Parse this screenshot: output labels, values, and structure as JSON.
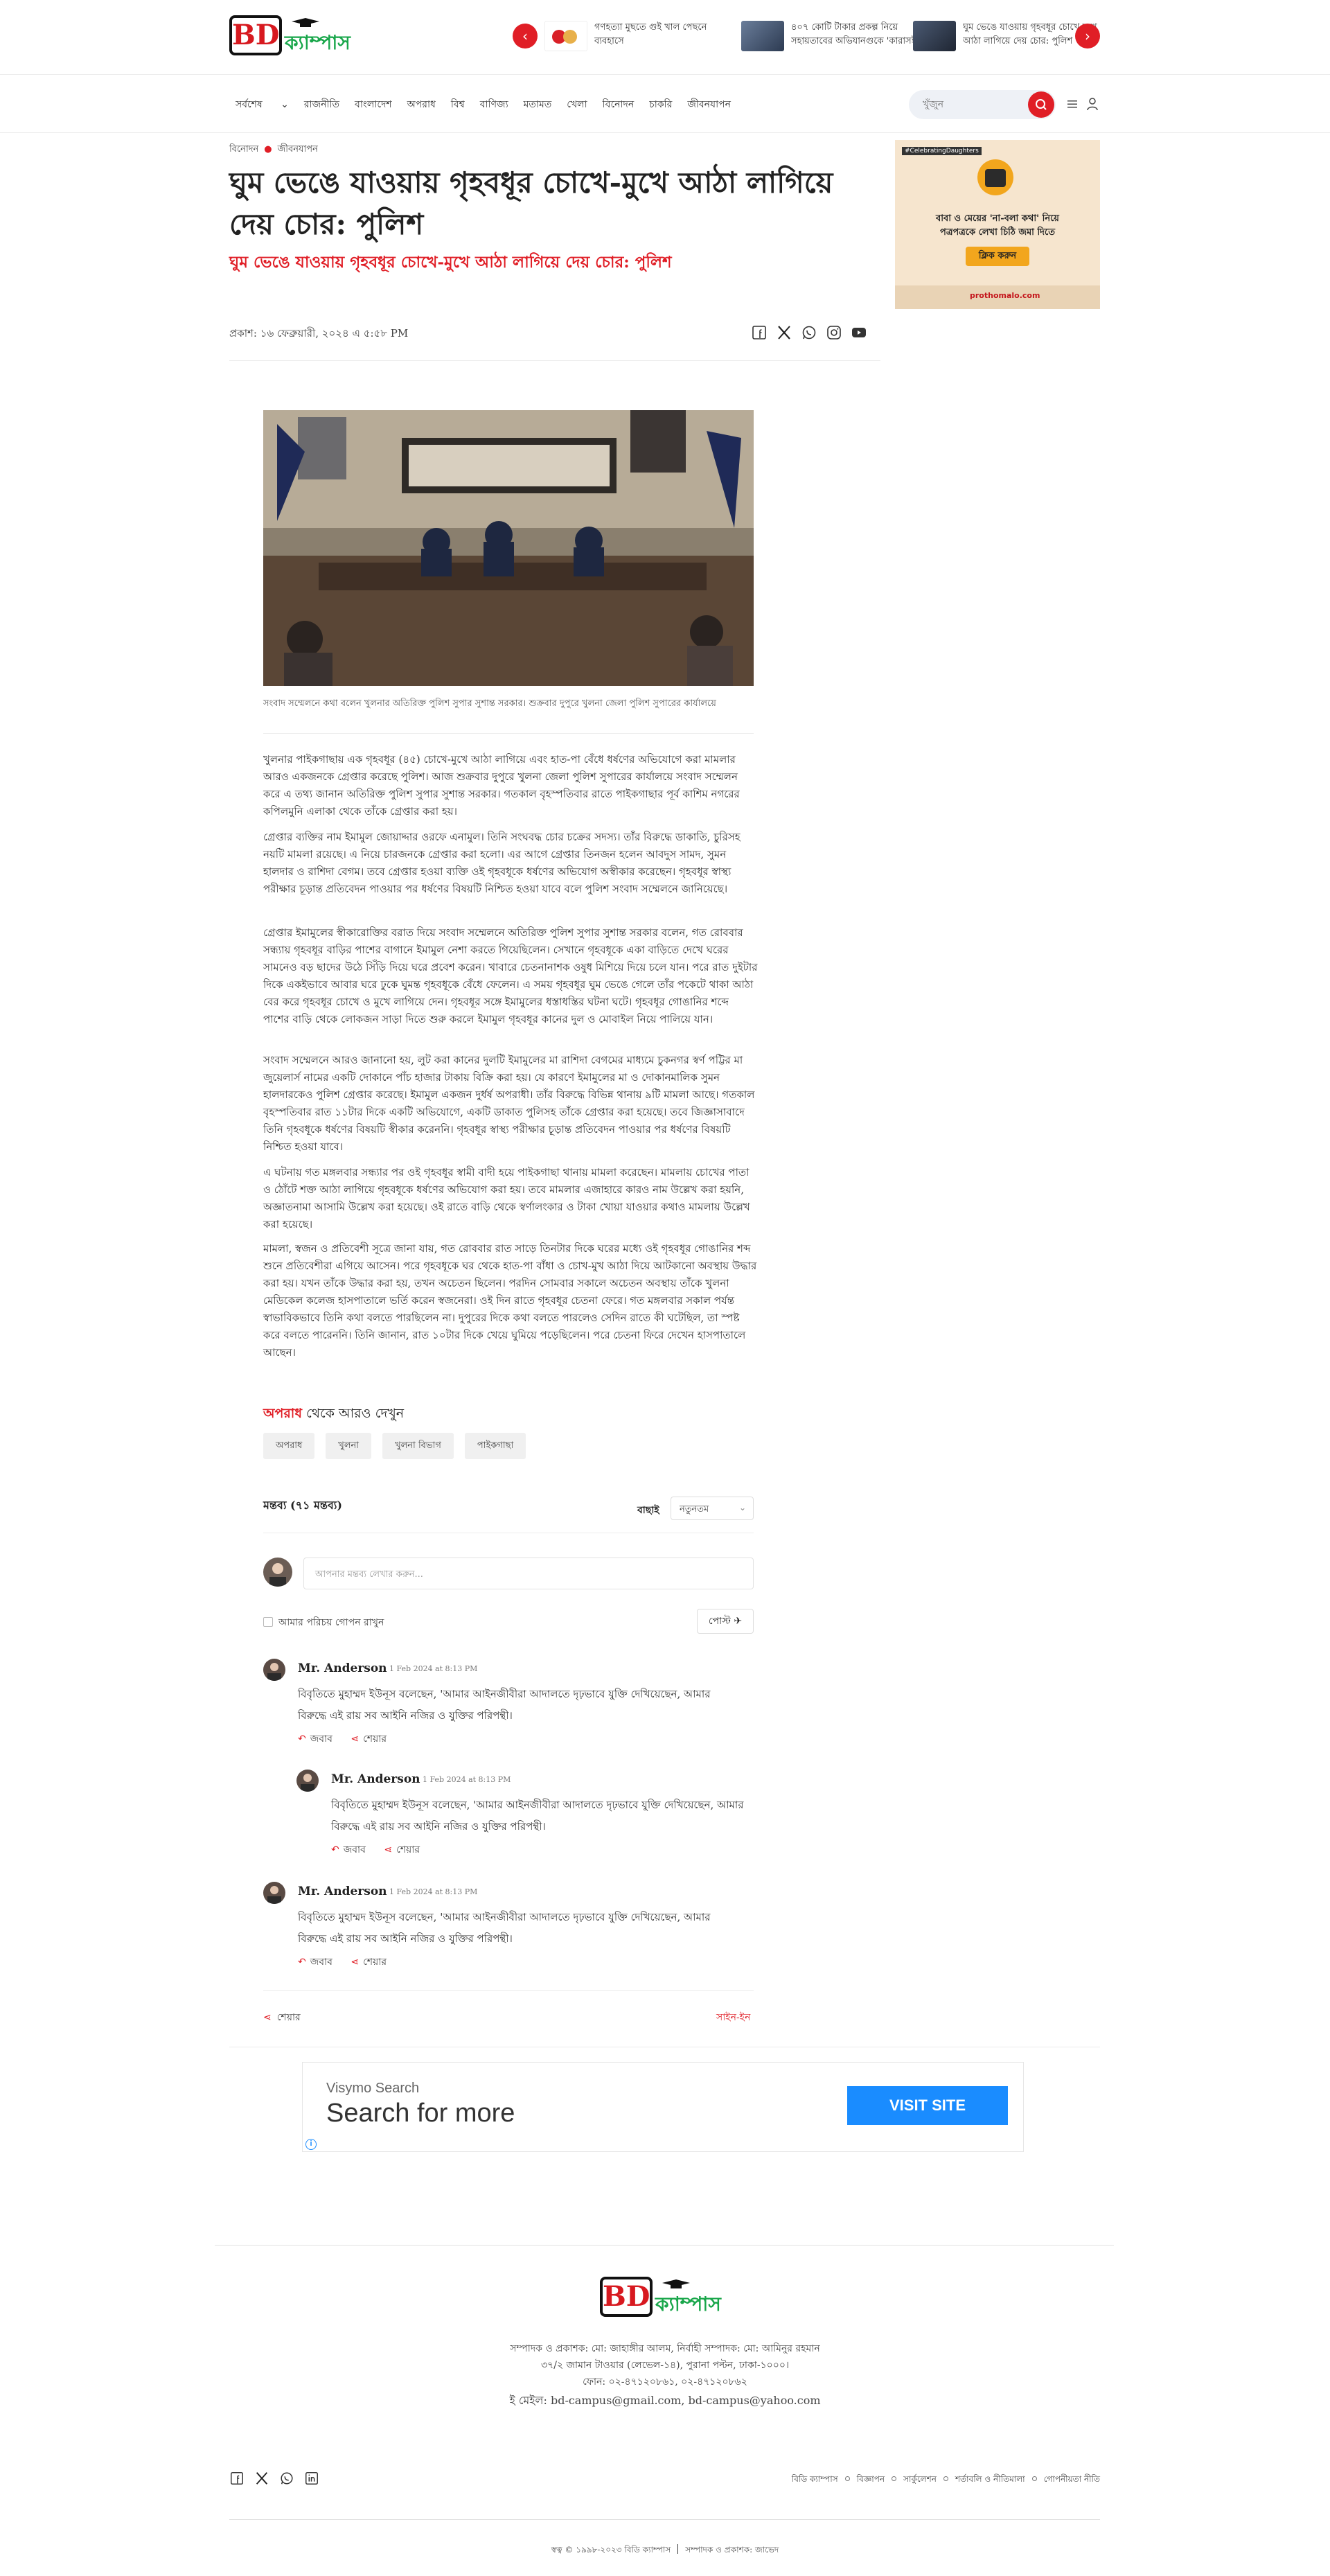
{
  "header": {
    "logo_bd": "BD",
    "logo_campus": "ক্যাম্পাস",
    "ticker": [
      "গণহত্যা মুছতে গুই খাল পেছনে ব্যবহাসে",
      "৪০৭ কোটি টাকার প্রকল্প নিয়ে সহায়তাবের অভিযানগুকে 'কারাসই...",
      "ঘুম ভেঙে যাওয়ায় গৃহবধূর চোখে-মুখে আঠা লাগিয়ে দেয় চোর: পুলিশ"
    ]
  },
  "nav": {
    "items": [
      "সর্বশেষ",
      "রাজনীতি",
      "বাংলাদেশ",
      "অপরাধ",
      "বিশ্ব",
      "বাণিজ্য",
      "মতামত",
      "খেলা",
      "বিনোদন",
      "চাকরি",
      "জীবনযাপন"
    ],
    "search_placeholder": "খুঁজুন"
  },
  "article": {
    "breadcrumb": [
      "বিনোদন",
      "জীবনযাপন"
    ],
    "title": "ঘুম ভেঙে যাওয়ায় গৃহবধূর চোখে-মুখে আঠা লাগিয়ে দেয় চোর: পুলিশ",
    "subtitle": "ঘুম ভেঙে যাওয়ায় গৃহবধূর চোখে-মুখে আঠা লাগিয়ে দেয় চোর: পুলিশ",
    "published": "প্রকাশ: ১৬ ফেব্রুয়ারী, ২০২৪ এ ৫:৫৮ PM",
    "photo_caption": "সংবাদ সম্মেলনে কথা বলেন খুলনার অতিরিক্ত পুলিশ সুপার সুশান্ত সরকার। শুক্রবার দুপুরে খুলনা জেলা পুলিশ সুপারের কার্যালয়ে",
    "paragraphs": [
      "খুলনার পাইকগাছায় এক গৃহবধূর (৪৫) চোখে-মুখে আঠা লাগিয়ে এবং হাত-পা বেঁধে ধর্ষণের অভিযোগে করা মামলার আরও একজনকে গ্রেপ্তার করেছে পুলিশ। আজ শুক্রবার দুপুরে খুলনা জেলা পুলিশ সুপারের কার্যালয়ে সংবাদ সম্মেলন করে এ তথ্য জানান অতিরিক্ত পুলিশ সুপার সুশান্ত সরকার। গতকাল বৃহস্পতিবার রাতে পাইকগাছার পূর্ব কাশিম নগরের কপিলমুনি এলাকা থেকে তাঁকে গ্রেপ্তার করা হয়।",
      "গ্রেপ্তার ব্যক্তির নাম ইমামুল জোয়াদ্দার ওরফে এনামুল। তিনি সংঘবদ্ধ চোর চক্রের সদস্য। তাঁর বিরুদ্ধে ডাকাতি, চুরিসহ নয়টি মামলা রয়েছে। এ নিয়ে চারজনকে গ্রেপ্তার করা হলো। এর আগে গ্রেপ্তার তিনজন হলেন আবদুস সামদ, সুমন হালদার ও রাশিদা বেগম। তবে গ্রেপ্তার হওয়া ব্যক্তি ওই গৃহবধূকে ধর্ষণের অভিযোগ অস্বীকার করেছেন। গৃহবধূর স্বাস্থ্য পরীক্ষার চূড়ান্ত প্রতিবেদন পাওয়ার পর ধর্ষণের বিষয়টি নিশ্চিত হওয়া যাবে বলে পুলিশ সংবাদ সম্মেলনে জানিয়েছে।",
      "গ্রেপ্তার ইমামুলের স্বীকারোক্তির বরাত দিয়ে সংবাদ সম্মেলনে অতিরিক্ত পুলিশ সুপার সুশান্ত সরকার বলেন, গত রোববার সন্ধ্যায় গৃহবধূর বাড়ির পাশের বাগানে ইমামুল নেশা করতে গিয়েছিলেন। সেখানে গৃহবধূকে একা বাড়িতে দেখে ঘরের সামনেও বড় ছাদের উঠে সিঁড়ি দিয়ে ঘরে প্রবেশ করেন। খাবারে চেতনানাশক ওষুধ মিশিয়ে দিয়ে চলে যান। পরে রাত দুইটার দিকে একইভাবে আবার ঘরে ঢুকে ঘুমন্ত গৃহবধূকে বেঁধে ফেলেন। এ সময় গৃহবধূর ঘুম ভেঙে গেলে তাঁর পকেটে থাকা আঠা বের করে গৃহবধূর চোখে ও মুখে লাগিয়ে দেন। গৃহবধূর সঙ্গে ইমামুলের ধস্তাধস্তির ঘটনা ঘটে। গৃহবধূর গোঙানির শব্দে পাশের বাড়ি থেকে লোকজন সাড়া দিতে শুরু করলে ইমামুল গৃহবধূর কানের দুল ও মোবাইল নিয়ে পালিয়ে যান।",
      "সংবাদ সম্মেলনে আরও জানানো হয়, লুট করা কানের দুলটি ইমামুলের মা রাশিদা বেগমের মাধ্যমে চুকনগর স্বর্ণ পট্টির মা জুয়েলার্স নামের একটি দোকানে পাঁচ হাজার টাকায় বিক্রি করা হয়। যে কারণে ইমামুলের মা ও দোকানমালিক সুমন হালদারকেও পুলিশ গ্রেপ্তার করেছে। ইমামুল একজন দুর্ধর্ষ অপরাধী। তাঁর বিরুদ্ধে বিভিন্ন থানায় ৯টি মামলা আছে। গতকাল বৃহস্পতিবার রাত ১১টার দিকে একটি অভিযোগে, একটি ডাকাত পুলিসহ তাঁকে গ্রেপ্তার করা হয়েছে। তবে জিজ্ঞাসাবাদে তিনি গৃহবধূকে ধর্ষণের বিষয়টি স্বীকার করেননি। গৃহবধূর স্বাস্থ্য পরীক্ষার চূড়ান্ত প্রতিবেদন পাওয়ার পর ধর্ষণের বিষয়টি নিশ্চিত হওয়া যাবে।",
      "এ ঘটনায় গত মঙ্গলবার সন্ধ্যার পর ওই গৃহবধূর স্বামী বাদী হয়ে পাইকগাছা থানায় মামলা করেছেন। মামলায় চোখের পাতা ও ঠোঁটে শক্ত আঠা লাগিয়ে গৃহবধূকে ধর্ষণের অভিযোগ করা হয়। তবে মামলার এজাহারে কারও নাম উল্লেখ করা হয়নি, অজ্ঞাতনামা আসামি উল্লেখ করা হয়েছে। ওই রাতে বাড়ি থেকে স্বর্ণালংকার ও টাকা খোয়া যাওয়ার কথাও মামলায় উল্লেখ করা হয়েছে।",
      "মামলা, স্বজন ও প্রতিবেশী সূত্রে জানা যায়, গত রোববার রাত সাড়ে তিনটার দিকে ঘরের মধ্যে ওই গৃহবধূর গোঙানির শব্দ শুনে প্রতিবেশীরা এগিয়ে আসেন। পরে গৃহবধূকে ঘর থেকে হাত-পা বাঁধা ও চোখ-মুখ আঠা দিয়ে আটকানো অবস্থায় উদ্ধার করা হয়। যখন তাঁকে উদ্ধার করা হয়, তখন অচেতন ছিলেন। পরদিন সোমবার সকালে অচেতন অবস্থায় তাঁকে খুলনা মেডিকেল কলেজ হাসপাতালে ভর্তি করেন স্বজনেরা। ওই দিন রাতে গৃহবধূর চেতনা ফেরে। গত মঙ্গলবার সকাল পর্যন্ত স্বাভাবিকভাবে তিনি কথা বলতে পারছিলেন না। দুপুরের দিকে কথা বলতে পারলেও সেদিন রাতে কী ঘটেছিল, তা স্পষ্ট করে বলতে পারেননি। তিনি জানান, রাত ১০টার দিকে খেয়ে ঘুমিয়ে পড়েছিলেন। পরে চেতনা ফিরে দেখেন হাসপাতালে আছেন।"
    ],
    "more_from_category": "অপরাধ",
    "more_suffix": " থেকে আরও দেখুন",
    "tags": [
      "অপরাধ",
      "খুলনা",
      "খুলনা বিভাগ",
      "পাইকগাছা"
    ]
  },
  "comments": {
    "heading": "মন্তব্য (৭১ মন্তব্য)",
    "sort_label": "বাছাই",
    "sort_value": "নতুনতম",
    "input_placeholder": "আপনার মন্তব্য লেখার করুন...",
    "anonymous_label": "আমার পরিচয় গোপন রাখুন",
    "post_label": "পোস্ট",
    "reply_label": "জবাব",
    "share_label": "শেয়ার",
    "items": [
      {
        "name": "Mr. Anderson",
        "time": "1 Feb 2024 at 8:13 PM",
        "text": "বিবৃতিতে মুহাম্মদ ইউনূস বলেছেন, 'আমার আইনজীবীরা আদালতে দৃঢ়ভাবে যুক্তি দেখিয়েছেন, আমার বিরুদ্ধে এই রায় সব আইনি নজির ও যুক্তির পরিপন্থী।"
      },
      {
        "name": "Mr. Anderson",
        "time": "1 Feb 2024 at 8:13 PM",
        "text": "বিবৃতিতে মুহাম্মদ ইউনূস বলেছেন, 'আমার আইনজীবীরা আদালতে দৃঢ়ভাবে যুক্তি দেখিয়েছেন, আমার বিরুদ্ধে এই রায় সব আইনি নজির ও যুক্তির পরিপন্থী।"
      },
      {
        "name": "Mr. Anderson",
        "time": "1 Feb 2024 at 8:13 PM",
        "text": "বিবৃতিতে মুহাম্মদ ইউনূস বলেছেন, 'আমার আইনজীবীরা আদালতে দৃঢ়ভাবে যুক্তি দেখিয়েছেন, আমার বিরুদ্ধে এই রায় সব আইনি নজির ও যুক্তির পরিপন্থী।"
      }
    ],
    "share_bottom": "শেয়ার",
    "signin": "সাইন-ইন"
  },
  "ads": {
    "right_top": "#CelebratingDaughters",
    "right_line1": "বাবা ও মেয়ের 'না-বলা কথা' নিয়ে",
    "right_line2": "পত্রপত্রকে লেখা চিঠি জমা দিতে",
    "right_button": "ক্লিক করুন",
    "right_site": "prothomalo.com",
    "bottom_brand": "Visymo Search",
    "bottom_headline": "Search for more",
    "bottom_button": "VISIT SITE",
    "bottom_info": "i"
  },
  "footer": {
    "lines": [
      "সম্পাদক ও প্রকাশক: মো: জাহাঙ্গীর আলম, নির্বাহী সম্পাদক: মো: আমিনুর রহমান",
      "৩৭/২ জামান টাওয়ার (লেভেল-১৪), পুরানা পল্টন, ঢাকা-১০০০।",
      "ফোন: ০২-৪৭১২০৮৬১, ০২-৪৭১২০৮৬২",
      "ই মেইল: bd-campus@gmail.com, bd-campus@yahoo.com"
    ],
    "links": [
      "বিডি ক্যাম্পাস",
      "বিজ্ঞাপন",
      "সার্কুলেশন",
      "শর্তাবলি ও নীতিমালা",
      "গোপনীয়তা নীতি"
    ],
    "copyright": "স্বত্ব © ১৯৯৮-২০২৩ বিডি ক্যাম্পাস",
    "copyright_right": "সম্পাদক ও প্রকাশক: জাভেদ"
  },
  "colors": {
    "accent": "#e01e26",
    "brand_green": "#18a64a",
    "ad_blue": "#1a8cff"
  }
}
